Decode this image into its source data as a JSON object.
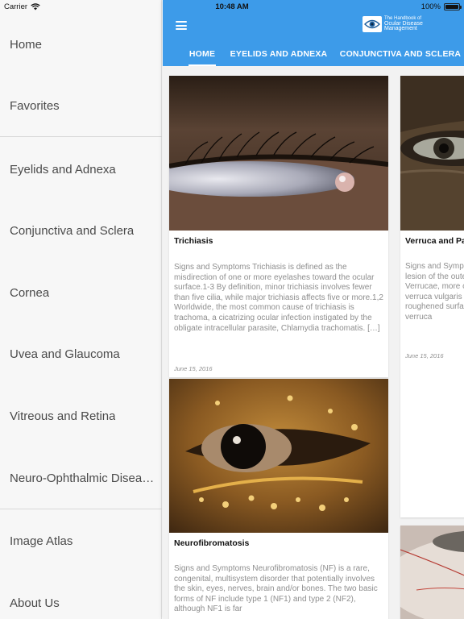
{
  "status_bar": {
    "carrier": "Carrier",
    "time": "10:48 AM",
    "battery_text": "100%",
    "battery_level": 1.0
  },
  "drawer": {
    "items": [
      {
        "label": "Home"
      },
      {
        "label": "Favorites"
      },
      {
        "label": "Eyelids and Adnexa"
      },
      {
        "label": "Conjunctiva and Sclera"
      },
      {
        "label": "Cornea"
      },
      {
        "label": "Uvea and Glaucoma"
      },
      {
        "label": "Vitreous and Retina"
      },
      {
        "label": "Neuro-Ophthalmic Diseases"
      },
      {
        "label": "Image Atlas"
      },
      {
        "label": "About Us"
      }
    ]
  },
  "header": {
    "menu_icon": "hamburger-menu-icon",
    "logo": {
      "line1": "The Handbook of",
      "line2": "Ocular Disease",
      "line3": "Management"
    },
    "tabs": [
      {
        "label": "HOME",
        "active": true
      },
      {
        "label": "EYELIDS AND ADNEXA",
        "active": false
      },
      {
        "label": "CONJUNCTIVA AND SCLERA",
        "active": false
      }
    ],
    "colors": {
      "appbar": "#3d9be9",
      "text": "#ffffff"
    }
  },
  "articles": [
    {
      "title": "Trichiasis",
      "excerpt": "Signs and Symptoms Trichiasis is defined as the misdirection of one or more eyelashes toward the ocular surface.1-3 By definition, minor trichiasis involves fewer than five cilia, while major trichiasis affects five or more.1,2 Worldwide, the most common cause of trichiasis is trachoma, a cicatrizing ocular infection instigated by the obligate intracellular parasite, Chlamydia trachomatis. […]",
      "date": "June 15, 2016"
    },
    {
      "title": "Verruca and Papilloma",
      "excerpt": "Signs and Symptoms A verruca is a small, multi-lobulated lesion of the outer layers of the skin and membranes.1-3 Verrucae, more commonly known, come in several forms: verruca vulgaris (the common wart) appears as a roughened surface on the hands, elbows and knees; verruca",
      "date": "June 15, 2016"
    },
    {
      "title": "Neurofibromatosis",
      "excerpt": "Signs and Symptoms Neurofibromatosis (NF) is a rare, congenital, multisystem disorder that potentially involves the skin, eyes, nerves, brain and/or bones. The two basic forms of NF include type 1 (NF1) and type 2 (NF2), although NF1 is far",
      "date": ""
    }
  ]
}
